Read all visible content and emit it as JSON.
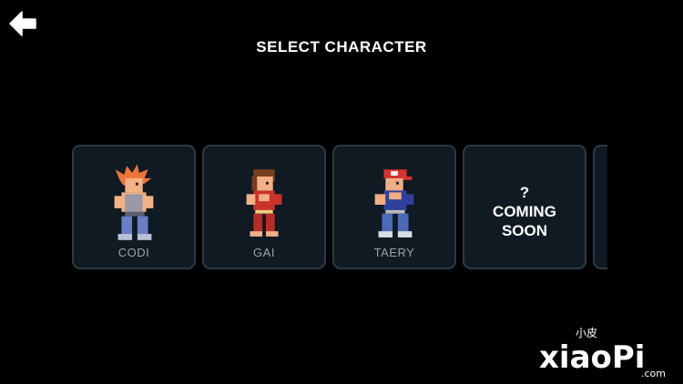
{
  "screen": {
    "title": "SELECT CHARACTER"
  },
  "back_button": {
    "icon": "back-arrow-icon"
  },
  "characters": [
    {
      "name": "CODI",
      "sprite": "codi-sprite"
    },
    {
      "name": "GAI",
      "sprite": "gai-sprite"
    },
    {
      "name": "TAERY",
      "sprite": "taery-sprite"
    }
  ],
  "locked_slot": {
    "mark": "?",
    "line1": "COMING",
    "line2": "SOON"
  },
  "watermark": {
    "top_text": "小皮",
    "main_text": "xiaoPi",
    "suffix": ".com"
  },
  "colors": {
    "background": "#000000",
    "card_bg": "#0f1a22",
    "card_border": "#2c3b44",
    "label": "#9aa3a8",
    "title": "#ffffff"
  }
}
